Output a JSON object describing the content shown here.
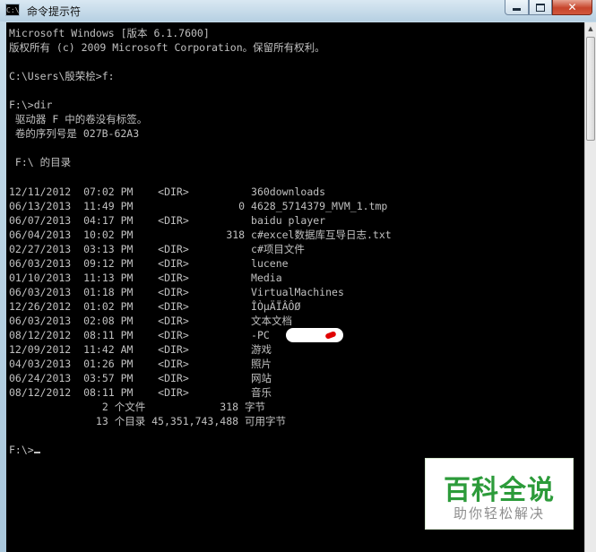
{
  "window": {
    "title": "命令提示符",
    "icon_text": "C:\\",
    "buttons": {
      "minimize": "minimize",
      "maximize": "maximize",
      "close": "✕"
    }
  },
  "console": {
    "lines": [
      "Microsoft Windows [版本 6.1.7600]",
      "版权所有 (c) 2009 Microsoft Corporation。保留所有权利。",
      "",
      "C:\\Users\\殷荣桧>f:",
      "",
      "F:\\>dir",
      " 驱动器 F 中的卷没有标签。",
      " 卷的序列号是 027B-62A3",
      "",
      " F:\\ 的目录",
      "",
      "12/11/2012  07:02 PM    <DIR>          360downloads",
      "06/13/2013  11:49 PM                 0 4628_5714379_MVM_1.tmp",
      "06/07/2013  04:17 PM    <DIR>          baidu player",
      "06/04/2013  10:02 PM               318 c#excel数据库互导日志.txt",
      "02/27/2013  03:13 PM    <DIR>          c#项目文件",
      "06/03/2013  09:12 PM    <DIR>          lucene",
      "01/10/2013  11:13 PM    <DIR>          Media",
      "06/03/2013  01:18 PM    <DIR>          VirtualMachines",
      "12/26/2012  01:02 PM    <DIR>          ÎÒµÄÏÂÔØ",
      "06/03/2013  02:08 PM    <DIR>          文本文档",
      "08/12/2012  08:11 PM    <DIR>          -PC",
      "12/09/2012  11:42 AM    <DIR>          游戏",
      "04/03/2013  01:26 PM    <DIR>          照片",
      "06/24/2013  03:57 PM    <DIR>          网站",
      "08/12/2012  08:11 PM    <DIR>          音乐",
      "               2 个文件            318 字节",
      "              13 个目录 45,351,743,488 可用字节",
      "",
      "F:\\>"
    ]
  },
  "watermark": {
    "main": "百科全说",
    "sub": "助你轻松解决"
  },
  "colors": {
    "console_bg": "#000000",
    "console_text": "#c0c0c0",
    "watermark_green": "#2c9b3a"
  }
}
